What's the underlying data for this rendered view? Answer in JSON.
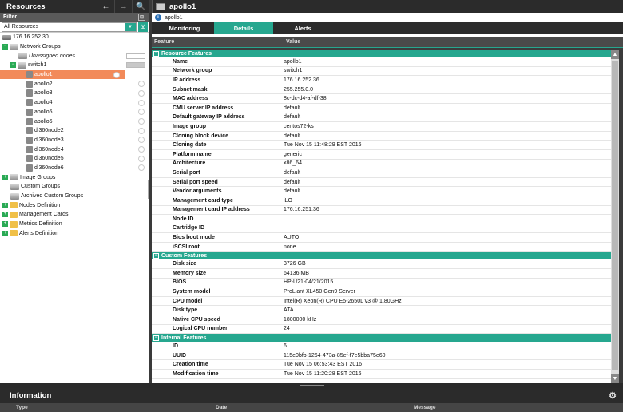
{
  "left": {
    "title": "Resources",
    "filter_label": "Filter",
    "filter_value": "All Resources",
    "tree": [
      {
        "label": "176.16.252.30",
        "indent": 0,
        "icon": "server-icon",
        "expander": ""
      },
      {
        "label": "Network Groups",
        "indent": 0,
        "icon": "group-icon",
        "expander": "−"
      },
      {
        "label": "Unassigned nodes",
        "indent": 2,
        "icon": "group-icon",
        "expander": "",
        "italic": true,
        "bar": "white"
      },
      {
        "label": "switch1",
        "indent": 1,
        "icon": "group-icon",
        "expander": "−",
        "bar": "gray"
      },
      {
        "label": "apollo1",
        "indent": 3,
        "icon": "node-icon",
        "expander": "",
        "selected": true,
        "status": true
      },
      {
        "label": "apollo2",
        "indent": 3,
        "icon": "node-icon",
        "expander": "",
        "status": true
      },
      {
        "label": "apollo3",
        "indent": 3,
        "icon": "node-icon",
        "expander": "",
        "status": true
      },
      {
        "label": "apollo4",
        "indent": 3,
        "icon": "node-icon",
        "expander": "",
        "status": true
      },
      {
        "label": "apollo5",
        "indent": 3,
        "icon": "node-icon",
        "expander": "",
        "status": true
      },
      {
        "label": "apollo6",
        "indent": 3,
        "icon": "node-icon",
        "expander": "",
        "status": true
      },
      {
        "label": "dl360node2",
        "indent": 3,
        "icon": "node-icon",
        "expander": "",
        "status": true
      },
      {
        "label": "dl360node3",
        "indent": 3,
        "icon": "node-icon",
        "expander": "",
        "status": true
      },
      {
        "label": "dl360node4",
        "indent": 3,
        "icon": "node-icon",
        "expander": "",
        "status": true
      },
      {
        "label": "dl360node5",
        "indent": 3,
        "icon": "node-icon",
        "expander": "",
        "status": true
      },
      {
        "label": "dl360node6",
        "indent": 3,
        "icon": "node-icon",
        "expander": "",
        "status": true
      },
      {
        "label": "Image Groups",
        "indent": 0,
        "icon": "group-icon",
        "expander": "+"
      },
      {
        "label": "Custom Groups",
        "indent": 1,
        "icon": "group-icon",
        "expander": ""
      },
      {
        "label": "Archived Custom Groups",
        "indent": 1,
        "icon": "group-icon",
        "expander": ""
      },
      {
        "label": "Nodes Definition",
        "indent": 0,
        "icon": "folder-icon",
        "expander": "+"
      },
      {
        "label": "Management Cards",
        "indent": 0,
        "icon": "folder-icon",
        "expander": "+"
      },
      {
        "label": "Metrics Definition",
        "indent": 0,
        "icon": "folder-icon",
        "expander": "+"
      },
      {
        "label": "Alerts Definition",
        "indent": 0,
        "icon": "folder-icon",
        "expander": "+"
      }
    ]
  },
  "right": {
    "title": "apollo1",
    "breadcrumb": "apollo1",
    "tabs": [
      "Monitoring",
      "Details",
      "Alerts"
    ],
    "active_tab": 1,
    "columns": {
      "feature": "Feature",
      "value": "Value"
    },
    "sections": [
      {
        "name": "Resource Features",
        "rows": [
          [
            "Name",
            "apollo1"
          ],
          [
            "Network group",
            "switch1"
          ],
          [
            "IP address",
            "176.16.252.36"
          ],
          [
            "Subnet mask",
            "255.255.0.0"
          ],
          [
            "MAC address",
            "8c-dc-d4-af-df-38"
          ],
          [
            "CMU server IP address",
            "default"
          ],
          [
            "Default gateway IP address",
            "default"
          ],
          [
            "Image group",
            "centos72-ks"
          ],
          [
            "Cloning block device",
            "default"
          ],
          [
            "Cloning date",
            "Tue Nov 15 11:48:29 EST 2016"
          ],
          [
            "Platform name",
            "generic"
          ],
          [
            "Architecture",
            "x86_64"
          ],
          [
            "Serial port",
            "default"
          ],
          [
            "Serial port speed",
            "default"
          ],
          [
            "Vendor arguments",
            "default"
          ],
          [
            "Management card type",
            "iLO"
          ],
          [
            "Management card IP address",
            "176.16.251.36"
          ],
          [
            "Node ID",
            ""
          ],
          [
            "Cartridge ID",
            ""
          ],
          [
            "Bios boot mode",
            "AUTO"
          ],
          [
            "iSCSI root",
            "none"
          ]
        ]
      },
      {
        "name": "Custom Features",
        "rows": [
          [
            "Disk size",
            "3726 GB"
          ],
          [
            "Memory size",
            "64136 MB"
          ],
          [
            "BIOS",
            "HP-U21-04/21/2015"
          ],
          [
            "System model",
            "ProLiant XL450 Gen9 Server"
          ],
          [
            "CPU model",
            "Intel(R) Xeon(R) CPU E5-2650L v3 @ 1.80GHz"
          ],
          [
            "Disk type",
            "ATA"
          ],
          [
            "Native CPU speed",
            "1800000 kHz"
          ],
          [
            "Logical CPU number",
            "24"
          ]
        ]
      },
      {
        "name": "Internal Features",
        "rows": [
          [
            "ID",
            "6"
          ],
          [
            "UUID",
            "115e0bfb-1264-473a-85ef-f7e5bba75e60"
          ],
          [
            "Creation time",
            "Tue Nov 15 06:53:43 EST 2016"
          ],
          [
            "Modification time",
            "Tue Nov 15 11:20:28 EST 2016"
          ]
        ]
      }
    ]
  },
  "information": {
    "title": "Information",
    "columns": [
      "Type",
      "Date",
      "Message"
    ]
  },
  "colors": {
    "accent": "#26a78f",
    "selected": "#f28a5a",
    "header_bg": "#2b2b2b"
  }
}
